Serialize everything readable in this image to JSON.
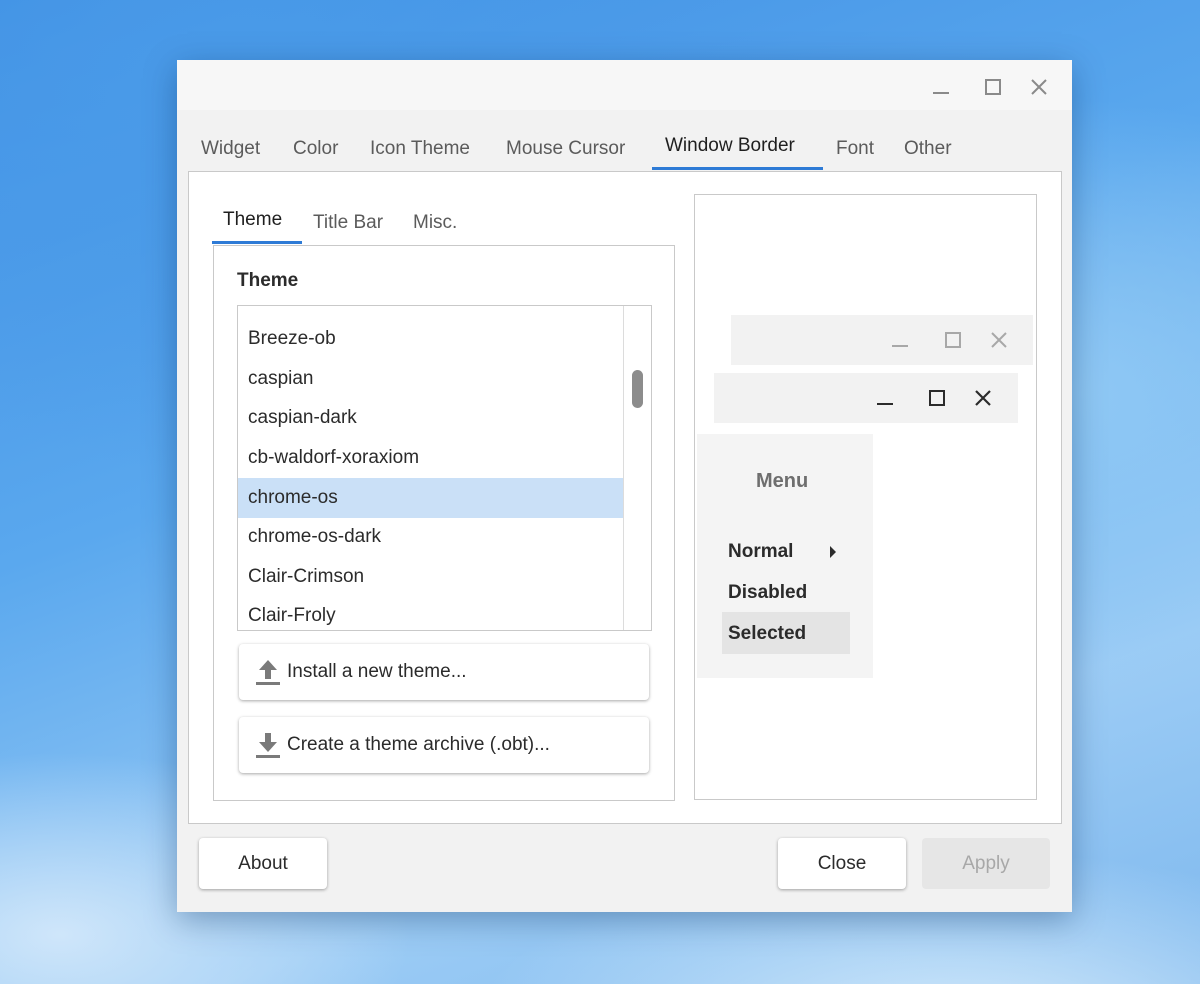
{
  "tabs": [
    "Widget",
    "Color",
    "Icon Theme",
    "Mouse Cursor",
    "Window Border",
    "Font",
    "Other"
  ],
  "active_tab": "Window Border",
  "subtabs": [
    "Theme",
    "Title Bar",
    "Misc."
  ],
  "active_subtab": "Theme",
  "section_title": "Theme",
  "theme_list": [
    "Breeze-ob",
    "caspian",
    "caspian-dark",
    "cb-waldorf-xoraxiom",
    "chrome-os",
    "chrome-os-dark",
    "Clair-Crimson",
    "Clair-Froly"
  ],
  "selected_theme": "chrome-os",
  "buttons": {
    "install": "Install a new theme...",
    "create_archive": "Create a theme archive (.obt)...",
    "about": "About",
    "close": "Close",
    "apply": "Apply"
  },
  "preview": {
    "menu_title": "Menu",
    "items": [
      "Normal",
      "Disabled",
      "Selected"
    ]
  },
  "colors": {
    "accent": "#2e7bd6",
    "selection": "#cae0f7"
  }
}
